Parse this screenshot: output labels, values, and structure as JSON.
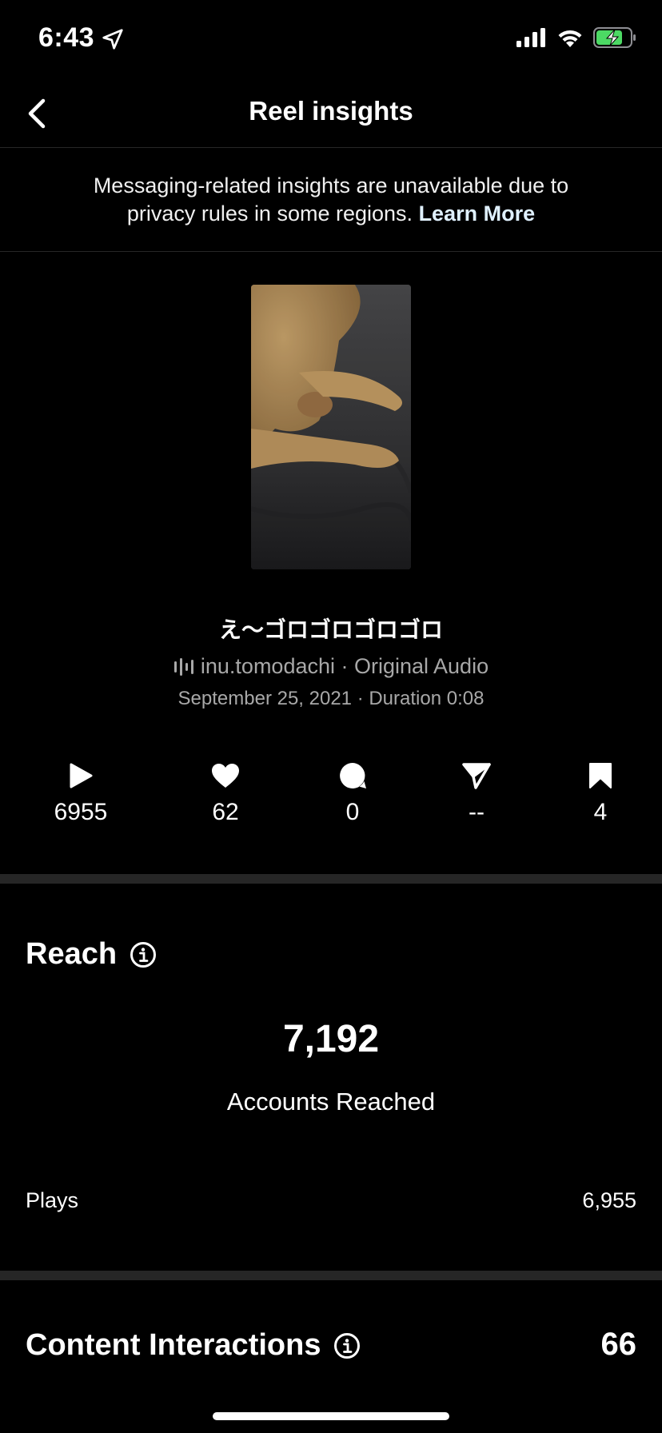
{
  "status_bar": {
    "time": "6:43",
    "icons": [
      "location-arrow-icon",
      "cellular-signal-icon",
      "wifi-icon",
      "battery-charging-icon"
    ],
    "battery_color": "#4cd964"
  },
  "header": {
    "title": "Reel insights",
    "back_icon": "chevron-left-icon"
  },
  "notice": {
    "text": "Messaging-related insights are unavailable due to privacy rules in some regions.",
    "link": "Learn More"
  },
  "reel": {
    "title": "え〜ゴロゴロゴロゴロ",
    "audio_icon": "audio-waveform-icon",
    "audio": "inu.tomodachi · Original Audio",
    "meta": "September 25, 2021 · Duration 0:08"
  },
  "stats": [
    {
      "icon": "play-icon",
      "value": "6955"
    },
    {
      "icon": "heart-icon",
      "value": "62"
    },
    {
      "icon": "comment-icon",
      "value": "0"
    },
    {
      "icon": "share-icon",
      "value": "--"
    },
    {
      "icon": "bookmark-icon",
      "value": "4"
    }
  ],
  "reach": {
    "title": "Reach",
    "value": "7,192",
    "label": "Accounts Reached",
    "plays_label": "Plays",
    "plays_value": "6,955"
  },
  "interactions": {
    "title": "Content Interactions",
    "value": "66"
  }
}
